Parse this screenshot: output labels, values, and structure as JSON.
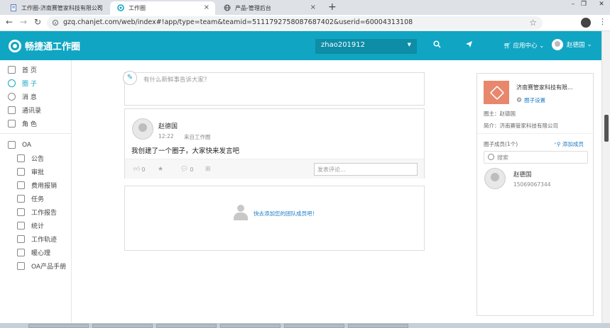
{
  "browser": {
    "tabs": [
      {
        "title": "工作圈-济南赛管家科技有限公司",
        "active": false
      },
      {
        "title": "工作圈",
        "active": true
      },
      {
        "title": "产品-管理后台",
        "active": false
      }
    ],
    "url": "gzq.chanjet.com/web/index#!app/type=team&teamid=5111792758087687402&userid=60004313108"
  },
  "header": {
    "logo_text": "畅捷通工作圈",
    "team_selected": "zhao201912",
    "app_center": "应用中心",
    "user_name": "赵德国",
    "accent_color": "#10a6c3"
  },
  "sidebar": {
    "items": [
      {
        "label": "首 页",
        "icon": "home-icon",
        "active": false
      },
      {
        "label": "圈 子",
        "icon": "circle-icon",
        "active": true
      },
      {
        "label": "消 息",
        "icon": "message-icon",
        "active": false
      },
      {
        "label": "通讯录",
        "icon": "contacts-icon",
        "active": false
      },
      {
        "label": "角 色",
        "icon": "role-icon",
        "active": false
      }
    ],
    "oa_label": "OA",
    "oa_items": [
      {
        "label": "公告",
        "icon": "announcement-icon"
      },
      {
        "label": "审批",
        "icon": "approval-icon"
      },
      {
        "label": "费用报销",
        "icon": "expense-icon"
      },
      {
        "label": "任务",
        "icon": "task-icon"
      },
      {
        "label": "工作报告",
        "icon": "report-icon"
      },
      {
        "label": "统计",
        "icon": "stats-icon"
      },
      {
        "label": "工作轨迹",
        "icon": "track-icon"
      },
      {
        "label": "暖心理",
        "icon": "care-icon"
      },
      {
        "label": "OA产品手册",
        "icon": "manual-icon"
      }
    ]
  },
  "compose": {
    "placeholder": "有什么新鲜事告诉大家？"
  },
  "post": {
    "author": "赵德国",
    "time": "12:22",
    "source": "来自工作圈",
    "content": "我创建了一个圈子，大家快来发言吧",
    "likes": "0",
    "comments": "0",
    "comment_placeholder": "发表评论..."
  },
  "invite": {
    "text": "快去添加您的团队成员吧！"
  },
  "team_panel": {
    "name": "济南赛管家科技有限...",
    "settings_label": "圈子设置",
    "owner": "圈主：赵德国",
    "intro": "简介：济南赛管家科技有限公司",
    "members_title": "圈子成员(1个)",
    "add_member": "添加成员",
    "search_placeholder": "搜索",
    "members": [
      {
        "name": "赵德国",
        "phone": "15069067344"
      }
    ]
  }
}
